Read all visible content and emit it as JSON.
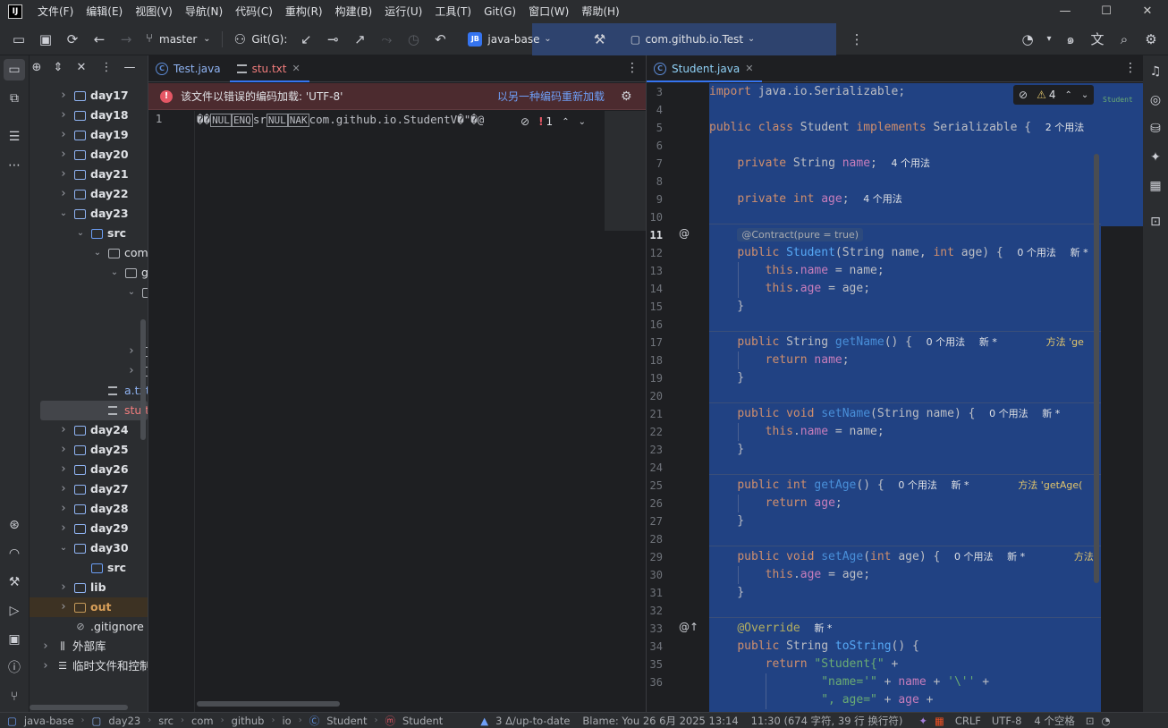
{
  "app": {
    "logo": "IJ"
  },
  "menu": [
    "文件(F)",
    "编辑(E)",
    "视图(V)",
    "导航(N)",
    "代码(C)",
    "重构(R)",
    "构建(B)",
    "运行(U)",
    "工具(T)",
    "Git(G)",
    "窗口(W)",
    "帮助(H)"
  ],
  "window_controls": {
    "minimize": "—",
    "maximize": "☐",
    "close": "✕"
  },
  "toolbar": {
    "branch": "master",
    "git_label": "Git(G):",
    "project_badge": "JB",
    "project_name": "java-base",
    "run_config": "com.github.io.Test"
  },
  "project_tree": [
    {
      "label": "day17",
      "depth": 0,
      "arrow": "›",
      "type": "folder"
    },
    {
      "label": "day18",
      "depth": 0,
      "arrow": "›",
      "type": "folder"
    },
    {
      "label": "day19",
      "depth": 0,
      "arrow": "›",
      "type": "folder"
    },
    {
      "label": "day20",
      "depth": 0,
      "arrow": "›",
      "type": "folder"
    },
    {
      "label": "day21",
      "depth": 0,
      "arrow": "›",
      "type": "folder"
    },
    {
      "label": "day22",
      "depth": 0,
      "arrow": "›",
      "type": "folder"
    },
    {
      "label": "day23",
      "depth": 0,
      "arrow": "⌄",
      "type": "folder"
    },
    {
      "label": "src",
      "depth": 1,
      "arrow": "⌄",
      "type": "src"
    },
    {
      "label": "com",
      "depth": 2,
      "arrow": "⌄",
      "type": "pkg"
    },
    {
      "label": "g",
      "depth": 3,
      "arrow": "⌄",
      "type": "pkg"
    },
    {
      "label": "[",
      "depth": 4,
      "arrow": "⌄",
      "type": "pkg"
    },
    {
      "label": "",
      "depth": 5,
      "arrow": "",
      "type": "none"
    },
    {
      "label": "",
      "depth": 5,
      "arrow": "",
      "type": "none"
    },
    {
      "label": "[",
      "depth": 4,
      "arrow": "›",
      "type": "pkg"
    },
    {
      "label": "[",
      "depth": 4,
      "arrow": "›",
      "type": "pkg"
    },
    {
      "label": "a.txt",
      "depth": 2,
      "arrow": "",
      "type": "file",
      "style": "blue"
    },
    {
      "label": "stu.txt",
      "depth": 2,
      "arrow": "",
      "type": "file",
      "style": "red",
      "selected": true
    },
    {
      "label": "day24",
      "depth": 0,
      "arrow": "›",
      "type": "folder"
    },
    {
      "label": "day25",
      "depth": 0,
      "arrow": "›",
      "type": "folder"
    },
    {
      "label": "day26",
      "depth": 0,
      "arrow": "›",
      "type": "folder"
    },
    {
      "label": "day27",
      "depth": 0,
      "arrow": "›",
      "type": "folder"
    },
    {
      "label": "day28",
      "depth": 0,
      "arrow": "›",
      "type": "folder"
    },
    {
      "label": "day29",
      "depth": 0,
      "arrow": "›",
      "type": "folder"
    },
    {
      "label": "day30",
      "depth": 0,
      "arrow": "⌄",
      "type": "folder"
    },
    {
      "label": "src",
      "depth": 1,
      "arrow": "",
      "type": "src"
    },
    {
      "label": "lib",
      "depth": 0,
      "arrow": "›",
      "type": "folder-plain"
    },
    {
      "label": "out",
      "depth": 0,
      "arrow": "›",
      "type": "folder-orange",
      "style": "orange"
    },
    {
      "label": ".gitignore",
      "depth": 0,
      "arrow": "",
      "type": "ignore"
    },
    {
      "label": "外部库",
      "depth": -1,
      "arrow": "›",
      "type": "lib"
    },
    {
      "label": "临时文件和控制",
      "depth": -1,
      "arrow": "›",
      "type": "scratch"
    }
  ],
  "left_editor": {
    "tabs": [
      {
        "label": "Test.java",
        "kind": "java",
        "active": false
      },
      {
        "label": "stu.txt",
        "kind": "txt",
        "active": true
      }
    ],
    "banner_text": "该文件以错误的编码加载: 'UTF-8'",
    "banner_link": "以另一种编码重新加载",
    "line_number": "1",
    "content_prefix": "��",
    "ctl1": "NUL",
    "ctl2": "ENQ",
    "content_mid": "sr",
    "ctl3": "NUL",
    "ctl4": "NAK",
    "content_suffix": "com.github.io.StudentV�\"�@",
    "error_count": "1"
  },
  "right_editor": {
    "tab": "Student.java",
    "warning_count": "4",
    "minimap_label": "Student",
    "line_numbers": [
      "3",
      "4",
      "5",
      "6",
      "7",
      "8",
      "9",
      "10",
      "11",
      "12",
      "13",
      "14",
      "15",
      "16",
      "17",
      "18",
      "19",
      "20",
      "21",
      "22",
      "23",
      "24",
      "25",
      "26",
      "27",
      "28",
      "29",
      "30",
      "31",
      "32",
      "33",
      "34",
      "35",
      "36"
    ],
    "hints": {
      "uses2": "2 个用法",
      "uses4": "4 个用法",
      "uses0": "0 个用法",
      "new": "新 *",
      "method_getname": "方法 'ge",
      "method_getage": "方法 'getAge(",
      "method_setage": "方法",
      "contract": "@Contract(pure = true)"
    }
  },
  "status": {
    "crumbs": [
      "java-base",
      "day23",
      "src",
      "com",
      "github",
      "io",
      "Student",
      "Student"
    ],
    "vcs": "3 Δ/up-to-date",
    "blame": "Blame: You 26 6月 2025 13:14",
    "position": "11:30 (674 字符, 39 行 换行符)",
    "line_sep": "CRLF",
    "encoding": "UTF-8",
    "indent": "4 个空格"
  },
  "colors": {
    "accent": "#3574f0",
    "selection": "#214283",
    "error": "#e55765",
    "warning": "#e0c46c"
  }
}
